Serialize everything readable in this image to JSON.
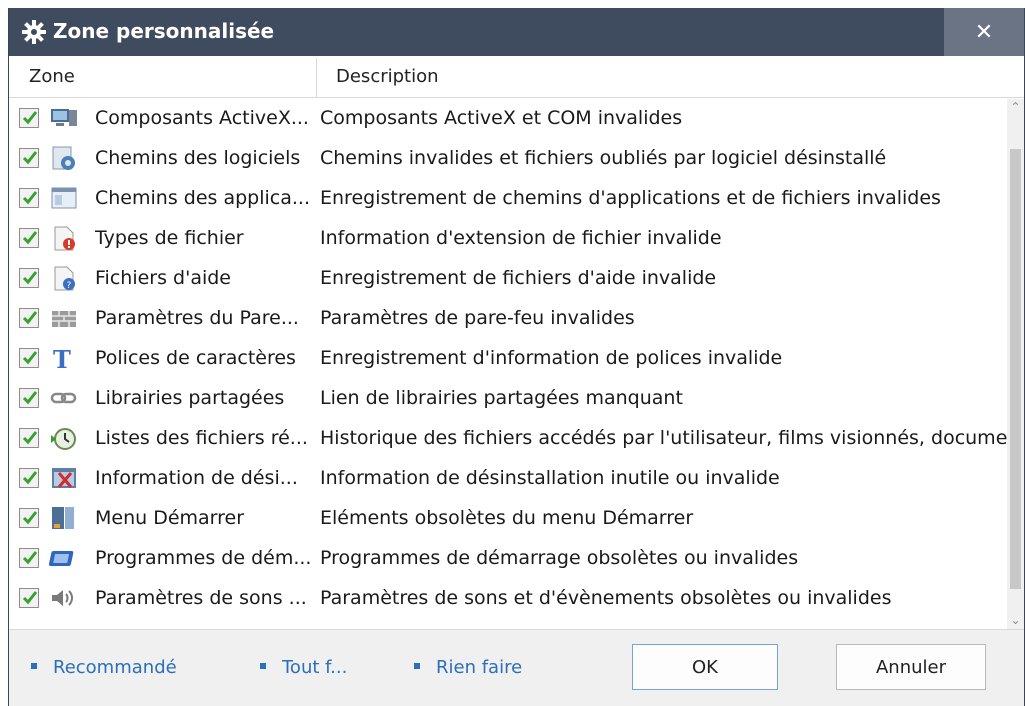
{
  "window": {
    "title": "Zone personnalisée",
    "close_label": "✕"
  },
  "columns": {
    "zone": "Zone",
    "description": "Description"
  },
  "rows": [
    {
      "zone": "Composants ActiveX...",
      "description": "Composants ActiveX et COM invalides",
      "icon": "monitor-icon",
      "checked": true
    },
    {
      "zone": "Chemins des logiciels",
      "description": "Chemins invalides et fichiers oubliés par logiciel désinstallé",
      "icon": "software-paths-icon",
      "checked": true
    },
    {
      "zone": "Chemins des applica...",
      "description": "Enregistrement de chemins d'applications et de fichiers invalides",
      "icon": "application-window-icon",
      "checked": true
    },
    {
      "zone": "Types de fichier",
      "description": "Information d'extension de fichier invalide",
      "icon": "file-type-error-icon",
      "checked": true
    },
    {
      "zone": "Fichiers d'aide",
      "description": "Enregistrement de fichiers d'aide invalide",
      "icon": "help-file-icon",
      "checked": true
    },
    {
      "zone": "Paramètres du Pare...",
      "description": "Paramètres de pare-feu invalides",
      "icon": "firewall-icon",
      "checked": true
    },
    {
      "zone": "Polices de caractères",
      "description": "Enregistrement d'information de polices invalide",
      "icon": "font-icon",
      "checked": true
    },
    {
      "zone": "Librairies partagées",
      "description": "Lien de librairies partagées manquant",
      "icon": "chain-link-icon",
      "checked": true
    },
    {
      "zone": "Listes des fichiers ré...",
      "description": "Historique des fichiers accédés par l'utilisateur, films visionnés, documen",
      "icon": "history-icon",
      "checked": true
    },
    {
      "zone": "Information de dési...",
      "description": "Information de désinstallation inutile ou invalide",
      "icon": "uninstall-icon",
      "checked": true
    },
    {
      "zone": "Menu Démarrer",
      "description": "Eléments obsolètes du menu Démarrer",
      "icon": "start-menu-icon",
      "checked": true
    },
    {
      "zone": "Programmes de dém...",
      "description": "Programmes de démarrage obsolètes ou invalides",
      "icon": "startup-programs-icon",
      "checked": true
    },
    {
      "zone": "Paramètres de sons ...",
      "description": "Paramètres de sons et d'évènements obsolètes ou invalides",
      "icon": "speaker-icon",
      "checked": true
    }
  ],
  "footer": {
    "link_recommended": "Recommandé",
    "link_all": "Tout f...",
    "link_none": "Rien faire",
    "ok_label": "OK",
    "cancel_label": "Annuler"
  },
  "colors": {
    "titlebar": "#3f4b5e",
    "close": "#6a7484",
    "link": "#2a6fb8",
    "check": "#3aa030"
  }
}
